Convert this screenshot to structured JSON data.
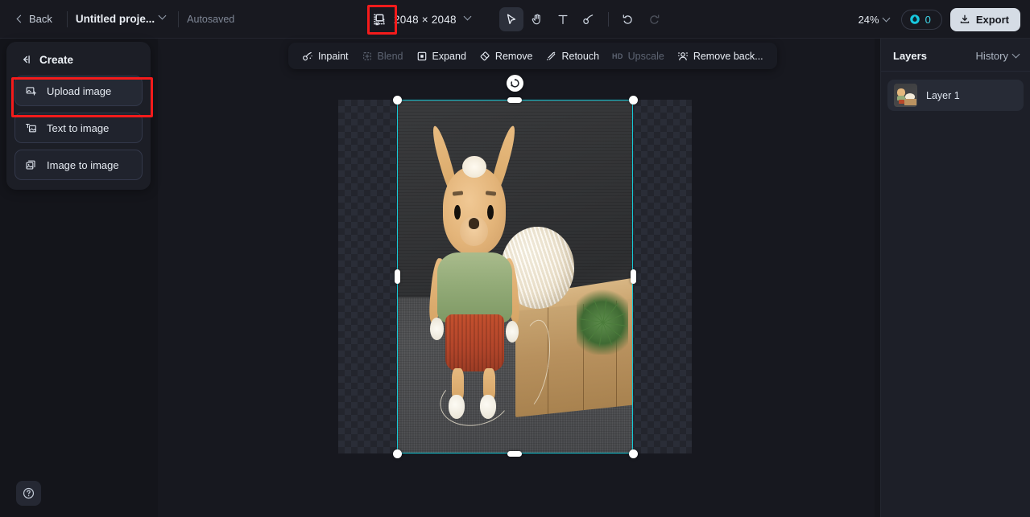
{
  "topbar": {
    "back_label": "Back",
    "project_name": "Untitled proje...",
    "autosaved_label": "Autosaved",
    "canvas_size_icon": "canvas-resize-icon",
    "dimensions": "2048 × 2048",
    "tools": [
      {
        "name": "select-tool",
        "icon": "cursor-arrow-icon",
        "active": true,
        "disabled": false
      },
      {
        "name": "pan-tool",
        "icon": "hand-icon",
        "active": false,
        "disabled": false
      },
      {
        "name": "text-tool",
        "icon": "text-t-icon",
        "active": false,
        "disabled": false
      },
      {
        "name": "brush-tool",
        "icon": "brush-icon",
        "active": false,
        "disabled": false
      },
      {
        "name": "undo-button",
        "icon": "undo-arrow-icon",
        "active": false,
        "disabled": false
      },
      {
        "name": "redo-button",
        "icon": "redo-arrow-icon",
        "active": false,
        "disabled": true
      }
    ],
    "zoom_level": "24%",
    "credits_icon": "credit-droplet-icon",
    "credits_value": "0",
    "export_label": "Export",
    "export_icon": "download-icon"
  },
  "create_panel": {
    "collapse_icon": "collapse-panel-icon",
    "title": "Create",
    "items": [
      {
        "label": "Upload image",
        "icon": "upload-image-icon",
        "highlighted": true
      },
      {
        "label": "Text to image",
        "icon": "text-to-image-icon",
        "highlighted": false
      },
      {
        "label": "Image to image",
        "icon": "image-to-image-icon",
        "highlighted": false
      }
    ]
  },
  "action_bar": {
    "items": [
      {
        "label": "Inpaint",
        "icon": "inpaint-brush-icon",
        "disabled": false,
        "badge": ""
      },
      {
        "label": "Blend",
        "icon": "blend-icon",
        "disabled": true,
        "badge": ""
      },
      {
        "label": "Expand",
        "icon": "expand-frame-icon",
        "disabled": false,
        "badge": ""
      },
      {
        "label": "Remove",
        "icon": "eraser-icon",
        "disabled": false,
        "badge": ""
      },
      {
        "label": "Retouch",
        "icon": "retouch-sparkle-icon",
        "disabled": false,
        "badge": ""
      },
      {
        "label": "Upscale",
        "icon": "upscale-icon",
        "disabled": true,
        "badge": "HD"
      },
      {
        "label": "Remove back...",
        "icon": "remove-background-icon",
        "disabled": false,
        "badge": ""
      }
    ]
  },
  "layers_panel": {
    "layers_tab": "Layers",
    "history_tab": "History",
    "layers": [
      {
        "name": "Layer 1",
        "thumb": "crochet-doll-thumbnail"
      }
    ]
  },
  "canvas": {
    "selection": {
      "rotate_handle_icon": "rotate-icon"
    },
    "artwork": "crochet-bunny-doll-with-yarn-ball-and-cardboard-box"
  },
  "help": {
    "icon": "help-question-icon"
  },
  "colors": {
    "accent_selection": "#17c9d6",
    "highlight_box": "#f41b1b",
    "credits_text": "#3fd6e8",
    "export_bg": "#d5dce5",
    "panel_bg": "#1d1f28",
    "canvas_bg": "#17181f"
  }
}
